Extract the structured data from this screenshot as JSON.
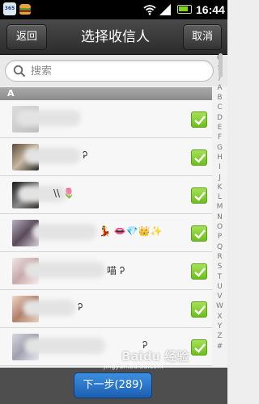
{
  "status_bar": {
    "calendar_app_label": "365",
    "time": "16:44"
  },
  "header": {
    "back_label": "返回",
    "title": "选择收信人",
    "cancel_label": "取消"
  },
  "search": {
    "placeholder": "搜索"
  },
  "section": {
    "letter": "A"
  },
  "contacts": [
    {
      "text": "",
      "checked": true
    },
    {
      "text": "Ꭾ",
      "checked": true
    },
    {
      "text": "\\\\ 🌷",
      "checked": true
    },
    {
      "text": "💃 👄💎👑✨",
      "checked": true
    },
    {
      "text": "喵 Ꭾ",
      "checked": true
    },
    {
      "text": "Ꭾ",
      "checked": true
    },
    {
      "text": "Ꭾ",
      "checked": true
    }
  ],
  "index_letters": [
    "Q",
    "$",
    "/",
    "A",
    "B",
    "C",
    "D",
    "E",
    "F",
    "G",
    "H",
    "I",
    "J",
    "K",
    "L",
    "M",
    "N",
    "O",
    "P",
    "Q",
    "R",
    "S",
    "T",
    "U",
    "V",
    "W",
    "X",
    "Y",
    "Z",
    "#"
  ],
  "footer": {
    "next_label": "下一步(289)"
  },
  "watermark": {
    "text": "Baidu 经验",
    "sub": "jingyan.baidu.com"
  },
  "colors": {
    "checkbox_green": "#7ed321",
    "next_button_blue": "#2a72c8",
    "title_bar": "#3a3a3a"
  }
}
